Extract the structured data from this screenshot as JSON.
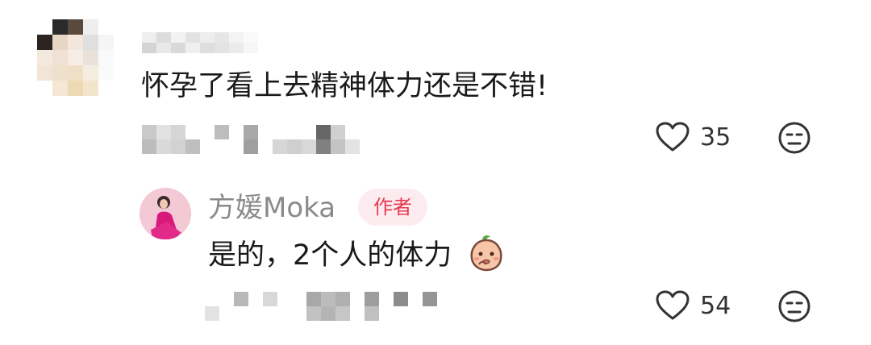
{
  "comment": {
    "text": "怀孕了看上去精神体力还是不错!",
    "like_count": "35"
  },
  "reply": {
    "author_name": "方媛Moka",
    "author_badge": "作者",
    "text": "是的，2个人的体力",
    "like_count": "54"
  },
  "icons": {
    "like": "heart-outline-icon",
    "dislike": "unamused-face-icon",
    "emoji": "peach-face-emoji"
  },
  "colors": {
    "badge_text": "#e8394f",
    "badge_bg": "#fdecef",
    "name_gray": "#8a8a8a"
  }
}
